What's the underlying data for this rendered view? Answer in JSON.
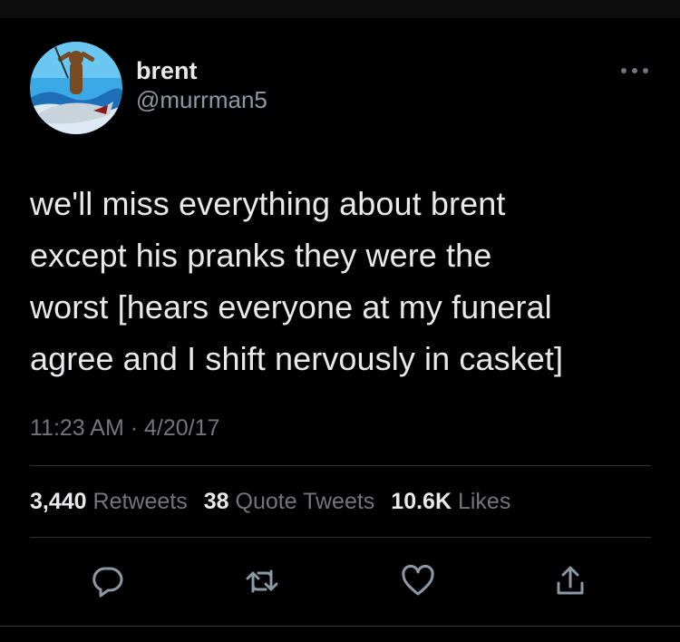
{
  "tweet": {
    "display_name": "brent",
    "handle": "@murrman5",
    "text": "we'll miss everything about brent\nexcept his pranks they were the\nworst [hears everyone at my funeral\nagree and I shift nervously in casket]",
    "time": "11:23 AM",
    "separator": "·",
    "date": "4/20/17"
  },
  "stats": {
    "retweets_count": "3,440",
    "retweets_label": "Retweets",
    "quotes_count": "38",
    "quotes_label": "Quote Tweets",
    "likes_count": "10.6K",
    "likes_label": "Likes"
  },
  "icons": {
    "more": "more-horizontal-icon",
    "reply": "reply-icon",
    "retweet": "retweet-icon",
    "like": "heart-icon",
    "share": "share-icon"
  },
  "colors": {
    "background": "#000000",
    "text_primary": "#e7e9ea",
    "text_secondary": "#71767b",
    "divider": "#2f3336"
  }
}
